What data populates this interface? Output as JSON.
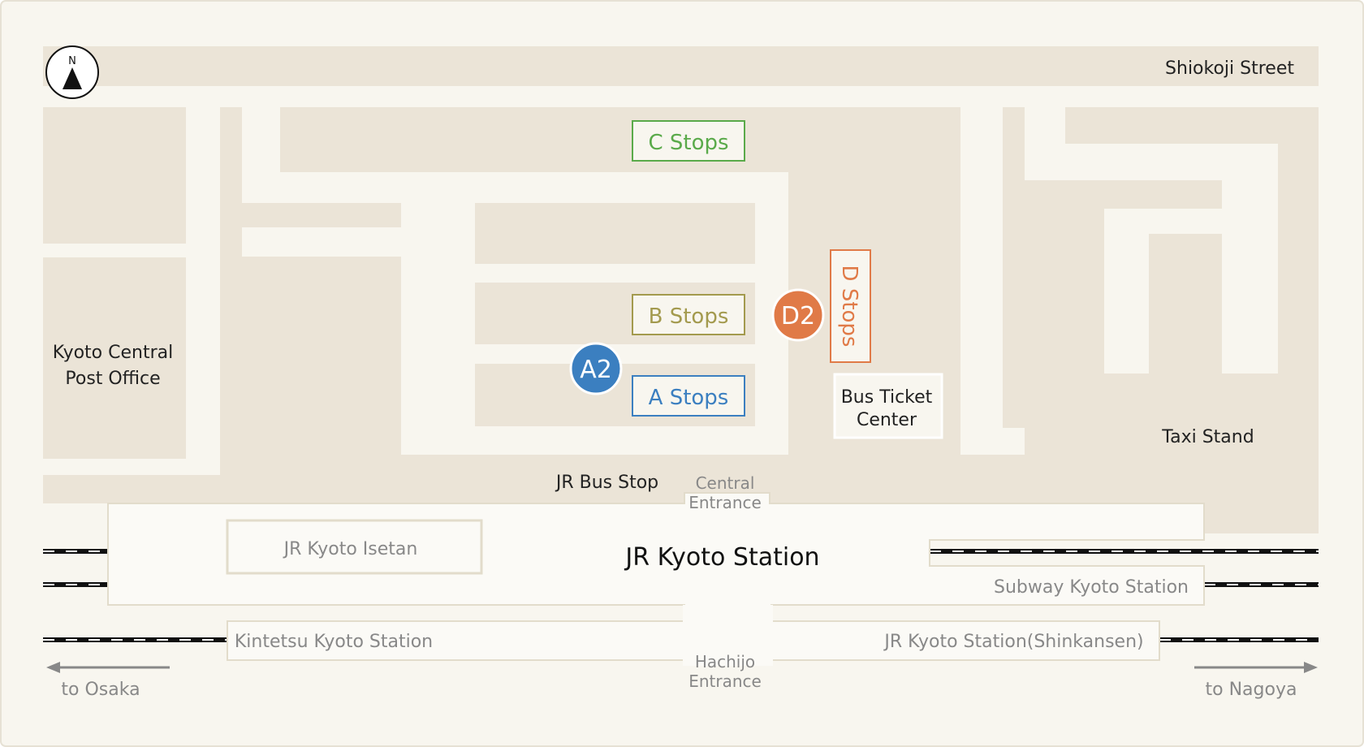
{
  "map": {
    "compass": "N",
    "streets": {
      "north": "Shiokoji Street"
    },
    "landmarks": {
      "post_office_line1": "Kyoto Central",
      "post_office_line2": "Post Office",
      "bus_ticket_line1": "Bus Ticket",
      "bus_ticket_line2": "Center",
      "taxi": "Taxi Stand",
      "jr_bus_stop": "JR Bus Stop"
    },
    "bus_stops": {
      "c": "C Stops",
      "b": "B Stops",
      "a": "A Stops",
      "d": "D Stops"
    },
    "markers": {
      "a2": "A2",
      "d2": "D2"
    },
    "station": {
      "main": "JR Kyoto Station",
      "central_line1": "Central",
      "central_line2": "Entrance",
      "hachijo_line1": "Hachijo",
      "hachijo_line2": "Entrance",
      "isetan": "JR Kyoto Isetan",
      "subway": "Subway Kyoto Station",
      "kintetsu": "Kintetsu Kyoto Station",
      "shinkansen": "JR Kyoto Station(Shinkansen)"
    },
    "directions": {
      "west": "to Osaka",
      "east": "to Nagoya"
    },
    "colors": {
      "a_stops": "#3b7fc0",
      "b_stops": "#a39a4e",
      "c_stops": "#5aaa4a",
      "d_stops": "#e07a47",
      "blocks": "#ebe4d7",
      "background": "#f8f6ef"
    }
  }
}
